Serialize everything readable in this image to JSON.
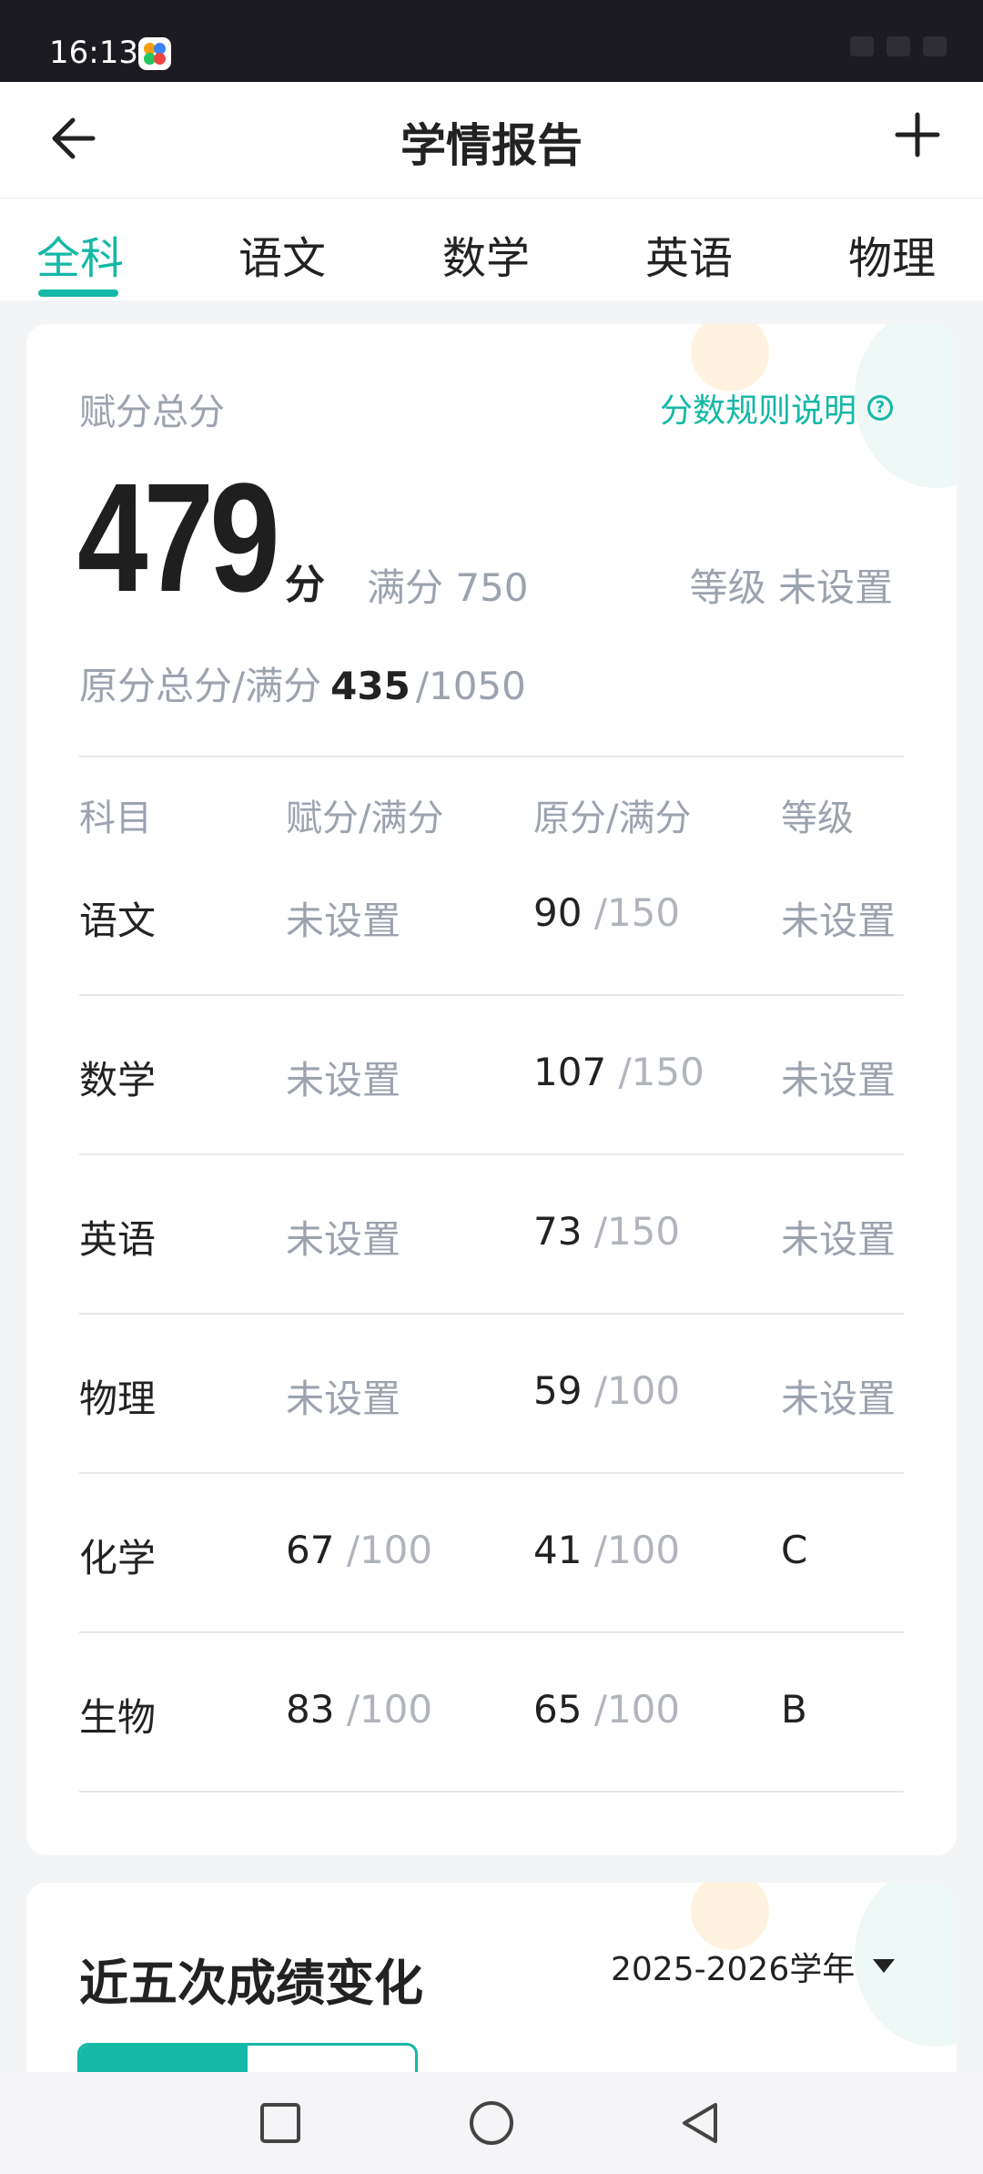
{
  "status": {
    "time": "16:13"
  },
  "header": {
    "title": "学情报告"
  },
  "tabs": [
    {
      "label": "全科",
      "active": true
    },
    {
      "label": "语文"
    },
    {
      "label": "数学"
    },
    {
      "label": "英语"
    },
    {
      "label": "物理"
    }
  ],
  "summary": {
    "score_label": "赋分总分",
    "rules_link": "分数规则说明",
    "score": "479",
    "score_unit": "分",
    "full_score": "满分 750",
    "grade": "等级 未设置",
    "raw_label": "原分总分/满分",
    "raw_score": "435",
    "raw_full": "/1050"
  },
  "table": {
    "headers": [
      "科目",
      "赋分/满分",
      "原分/满分",
      "等级"
    ],
    "rows": [
      {
        "subject": "语文",
        "assigned": "未设置",
        "raw": "90",
        "raw_full": "/150",
        "grade": "未设置"
      },
      {
        "subject": "数学",
        "assigned": "未设置",
        "raw": "107",
        "raw_full": "/150",
        "grade": "未设置"
      },
      {
        "subject": "英语",
        "assigned": "未设置",
        "raw": "73",
        "raw_full": "/150",
        "grade": "未设置"
      },
      {
        "subject": "物理",
        "assigned": "未设置",
        "raw": "59",
        "raw_full": "/100",
        "grade": "未设置"
      },
      {
        "subject": "化学",
        "assigned": "67",
        "assigned_full": "/100",
        "raw": "41",
        "raw_full": "/100",
        "grade": "C"
      },
      {
        "subject": "生物",
        "assigned": "83",
        "assigned_full": "/100",
        "raw": "65",
        "raw_full": "/100",
        "grade": "B"
      }
    ]
  },
  "trend": {
    "title": "近五次成绩变化",
    "year": "2025-2026学年"
  },
  "icons": {
    "back": "arrow-left-icon",
    "add": "plus-icon",
    "help": "question-circle-icon",
    "dropdown": "triangle-down-icon",
    "recents": "square-icon",
    "home": "circle-icon",
    "back_nav": "triangle-left-icon"
  },
  "colors": {
    "accent": "#14b8a6"
  }
}
